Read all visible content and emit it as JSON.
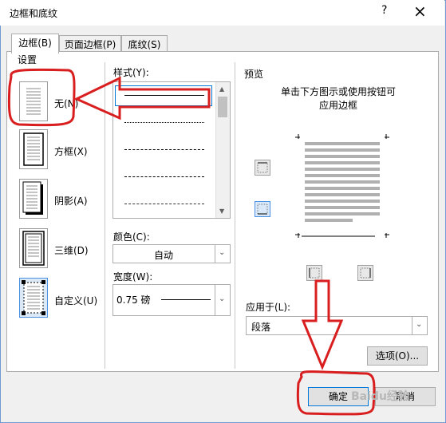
{
  "window": {
    "title": "边框和底纹",
    "help": "?",
    "close": "×"
  },
  "tabs": [
    {
      "label": "边框(B)",
      "active": true
    },
    {
      "label": "页面边框(P)",
      "active": false
    },
    {
      "label": "底纹(S)",
      "active": false
    }
  ],
  "setting": {
    "label": "设置",
    "items": [
      {
        "label": "无(N)",
        "icon": "none-border-icon",
        "selected": true
      },
      {
        "label": "方框(X)",
        "icon": "box-border-icon"
      },
      {
        "label": "阴影(A)",
        "icon": "shadow-border-icon"
      },
      {
        "label": "三维(D)",
        "icon": "3d-border-icon"
      },
      {
        "label": "自定义(U)",
        "icon": "custom-border-icon"
      }
    ]
  },
  "style": {
    "label": "样式(Y):",
    "lines": [
      "solid",
      "dotted",
      "dashed-small",
      "dashed",
      "dash-dot"
    ]
  },
  "color": {
    "label": "颜色(C):",
    "value": "自动"
  },
  "width": {
    "label": "宽度(W):",
    "value": "0.75 磅"
  },
  "preview": {
    "label": "预览",
    "hint_line1": "单击下方图示或使用按钮可",
    "hint_line2": "应用边框"
  },
  "apply_to": {
    "label": "应用于(L):",
    "value": "段落"
  },
  "buttons": {
    "options": "选项(O)...",
    "ok": "确定",
    "cancel": "取消"
  },
  "watermark": "Baidu经验",
  "colors": {
    "annotation": "#d81e1e",
    "accent": "#0078d7"
  }
}
